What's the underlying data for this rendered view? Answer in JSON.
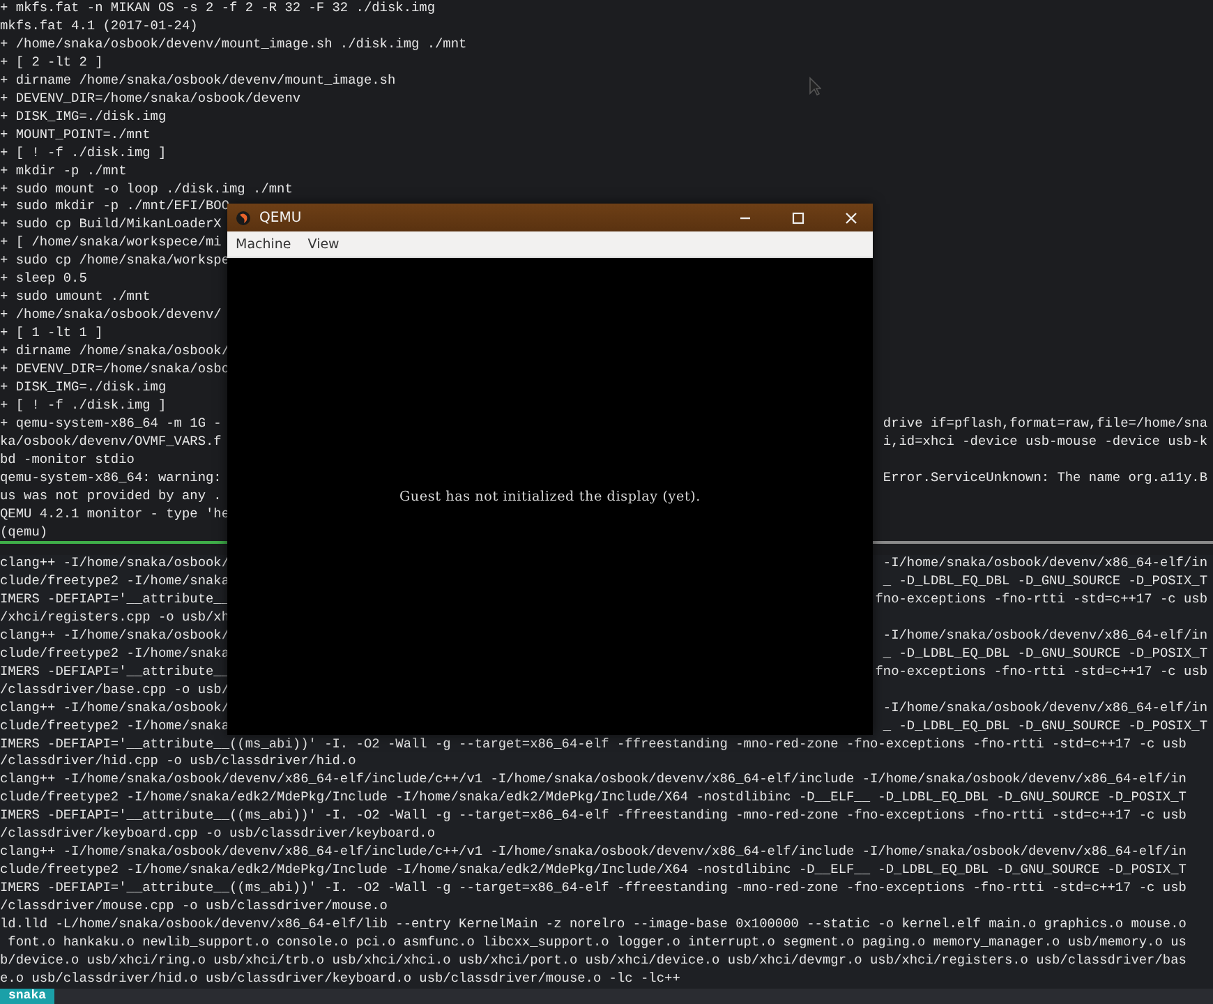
{
  "top_pane": {
    "lines": [
      {
        "left": "+ mkfs.fat -n MIKAN OS -s 2 -f 2 -R 32 -F 32 ./disk.img"
      },
      {
        "left": "mkfs.fat 4.1 (2017-01-24)"
      },
      {
        "left": "+ /home/snaka/osbook/devenv/mount_image.sh ./disk.img ./mnt"
      },
      {
        "left": "+ [ 2 -lt 2 ]"
      },
      {
        "left": "+ dirname /home/snaka/osbook/devenv/mount_image.sh"
      },
      {
        "left": "+ DEVENV_DIR=/home/snaka/osbook/devenv"
      },
      {
        "left": "+ DISK_IMG=./disk.img"
      },
      {
        "left": "+ MOUNT_POINT=./mnt"
      },
      {
        "left": "+ [ ! -f ./disk.img ]"
      },
      {
        "left": "+ mkdir -p ./mnt"
      },
      {
        "left": "+ sudo mount -o loop ./disk.img ./mnt"
      },
      {
        "left": "+ sudo mkdir -p ./mnt/EFI/BOO"
      },
      {
        "left": "+ sudo cp Build/MikanLoaderX"
      },
      {
        "left": "+ [ /home/snaka/workspece/mi"
      },
      {
        "left": "+ sudo cp /home/snaka/workspe"
      },
      {
        "left": "+ sleep 0.5"
      },
      {
        "left": "+ sudo umount ./mnt"
      },
      {
        "left": "+ /home/snaka/osbook/devenv/"
      },
      {
        "left": "+ [ 1 -lt 1 ]"
      },
      {
        "left": "+ dirname /home/snaka/osbook/"
      },
      {
        "left": "+ DEVENV_DIR=/home/snaka/osbo"
      },
      {
        "left": "+ DISK_IMG=./disk.img"
      },
      {
        "left": "+ [ ! -f ./disk.img ]"
      },
      {
        "left": "+ qemu-system-x86_64 -m 1G -",
        "right": "drive if=pflash,format=raw,file=/home/sna"
      },
      {
        "left": "ka/osbook/devenv/OVMF_VARS.f",
        "right": "i,id=xhci -device usb-mouse -device usb-k"
      },
      {
        "left": "bd -monitor stdio"
      },
      {
        "left": "qemu-system-x86_64: warning:",
        "right": "Error.ServiceUnknown: The name org.a11y.B"
      },
      {
        "left": "us was not provided by any ."
      },
      {
        "left": "QEMU 4.2.1 monitor - type 'he"
      },
      {
        "left": "(qemu)"
      }
    ]
  },
  "bottom_pane": {
    "lines": [
      {
        "left": "clang++ -I/home/snaka/osbook/",
        "right": "-I/home/snaka/osbook/devenv/x86_64-elf/in"
      },
      {
        "left": "clude/freetype2 -I/home/snaka",
        "right": "_ -D_LDBL_EQ_DBL -D_GNU_SOURCE -D_POSIX_T"
      },
      {
        "left": "IMERS -DEFIAPI='__attribute__",
        "right": "fno-exceptions -fno-rtti -std=c++17 -c usb"
      },
      {
        "left": "/xhci/registers.cpp -o usb/xh"
      },
      {
        "left": "clang++ -I/home/snaka/osbook/",
        "right": "-I/home/snaka/osbook/devenv/x86_64-elf/in"
      },
      {
        "left": "clude/freetype2 -I/home/snaka",
        "right": "_ -D_LDBL_EQ_DBL -D_GNU_SOURCE -D_POSIX_T"
      },
      {
        "left": "IMERS -DEFIAPI='__attribute__",
        "right": "fno-exceptions -fno-rtti -std=c++17 -c usb"
      },
      {
        "left": "/classdriver/base.cpp -o usb/"
      },
      {
        "left": "clang++ -I/home/snaka/osbook/",
        "right": "-I/home/snaka/osbook/devenv/x86_64-elf/in"
      },
      {
        "left": "clude/freetype2 -I/home/snaka",
        "right": "_ -D_LDBL_EQ_DBL -D_GNU_SOURCE -D_POSIX_T"
      },
      {
        "left": "IMERS -DEFIAPI='__attribute__((ms_abi))' -I. -O2 -Wall -g --target=x86_64-elf -ffreestanding -mno-red-zone -fno-exceptions -fno-rtti -std=c++17 -c usb"
      },
      {
        "left": "/classdriver/hid.cpp -o usb/classdriver/hid.o"
      },
      {
        "left": "clang++ -I/home/snaka/osbook/devenv/x86_64-elf/include/c++/v1 -I/home/snaka/osbook/devenv/x86_64-elf/include -I/home/snaka/osbook/devenv/x86_64-elf/in"
      },
      {
        "left": "clude/freetype2 -I/home/snaka/edk2/MdePkg/Include -I/home/snaka/edk2/MdePkg/Include/X64 -nostdlibinc -D__ELF__ -D_LDBL_EQ_DBL -D_GNU_SOURCE -D_POSIX_T"
      },
      {
        "left": "IMERS -DEFIAPI='__attribute__((ms_abi))' -I. -O2 -Wall -g --target=x86_64-elf -ffreestanding -mno-red-zone -fno-exceptions -fno-rtti -std=c++17 -c usb"
      },
      {
        "left": "/classdriver/keyboard.cpp -o usb/classdriver/keyboard.o"
      },
      {
        "left": "clang++ -I/home/snaka/osbook/devenv/x86_64-elf/include/c++/v1 -I/home/snaka/osbook/devenv/x86_64-elf/include -I/home/snaka/osbook/devenv/x86_64-elf/in"
      },
      {
        "left": "clude/freetype2 -I/home/snaka/edk2/MdePkg/Include -I/home/snaka/edk2/MdePkg/Include/X64 -nostdlibinc -D__ELF__ -D_LDBL_EQ_DBL -D_GNU_SOURCE -D_POSIX_T"
      },
      {
        "left": "IMERS -DEFIAPI='__attribute__((ms_abi))' -I. -O2 -Wall -g --target=x86_64-elf -ffreestanding -mno-red-zone -fno-exceptions -fno-rtti -std=c++17 -c usb"
      },
      {
        "left": "/classdriver/mouse.cpp -o usb/classdriver/mouse.o"
      },
      {
        "left": "ld.lld -L/home/snaka/osbook/devenv/x86_64-elf/lib --entry KernelMain -z norelro --image-base 0x100000 --static -o kernel.elf main.o graphics.o mouse.o"
      },
      {
        "left": " font.o hankaku.o newlib_support.o console.o pci.o asmfunc.o libcxx_support.o logger.o interrupt.o segment.o paging.o memory_manager.o usb/memory.o us"
      },
      {
        "left": "b/device.o usb/xhci/ring.o usb/xhci/trb.o usb/xhci/xhci.o usb/xhci/port.o usb/xhci/device.o usb/xhci/devmgr.o usb/xhci/registers.o usb/classdriver/bas"
      },
      {
        "left": "e.o usb/classdriver/hid.o usb/classdriver/keyboard.o usb/classdriver/mouse.o -lc -lc++"
      }
    ]
  },
  "status_bar": {
    "session": "snaka"
  },
  "qemu_window": {
    "title": "QEMU",
    "menu": [
      "Machine",
      "View"
    ],
    "message": "Guest has not initialized the display (yet)."
  }
}
